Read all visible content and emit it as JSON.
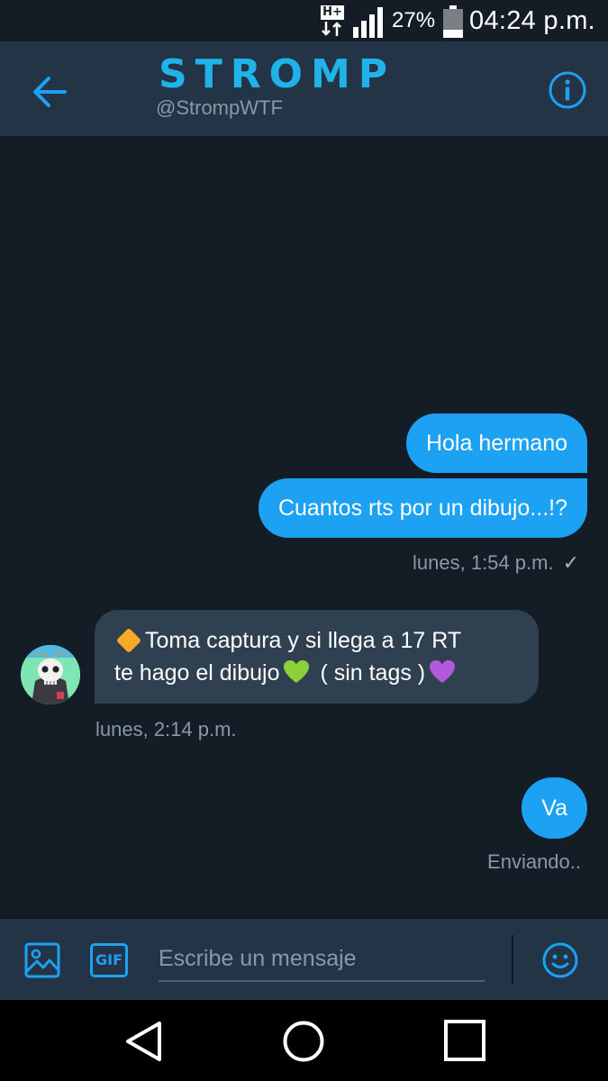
{
  "status_bar": {
    "network": "H+",
    "battery_percent": "27%",
    "battery_level": 0.27,
    "time": "04:24 p.m."
  },
  "header": {
    "title": "STROMP",
    "handle": "@StrompWTF",
    "back_icon": "arrow-left-icon",
    "info_icon": "info-icon",
    "accent_color": "#1da1f2",
    "logo_color": "#1fb3e9"
  },
  "messages": [
    {
      "direction": "sent",
      "text": "Hola hermano"
    },
    {
      "direction": "sent",
      "text": "Cuantos rts por un dibujo...!?"
    },
    {
      "direction": "received",
      "line1": "Toma captura y si llega a 17 RT",
      "line2_part1": "te hago el dibujo",
      "line2_part2": "( sin tags )",
      "emojis": [
        "orange-diamond",
        "green-heart",
        "purple-heart"
      ]
    },
    {
      "direction": "sent",
      "text": "Va"
    }
  ],
  "timestamps": {
    "sent_group": "lunes, 1:54 p.m.",
    "received": "lunes, 2:14 p.m.",
    "sending_status": "Enviando.."
  },
  "composer": {
    "placeholder": "Escribe un mensaje",
    "gif_label": "GIF",
    "photo_icon": "image-icon",
    "emoji_icon": "smiley-icon"
  },
  "nav_bar": {
    "back_icon": "triangle-back-icon",
    "home_icon": "circle-home-icon",
    "recent_icon": "square-recents-icon"
  },
  "colors": {
    "background": "#141d26",
    "header": "#243447",
    "sent_bubble": "#1da1f2",
    "received_bubble": "#2f4050",
    "secondary_text": "#8899a6"
  }
}
